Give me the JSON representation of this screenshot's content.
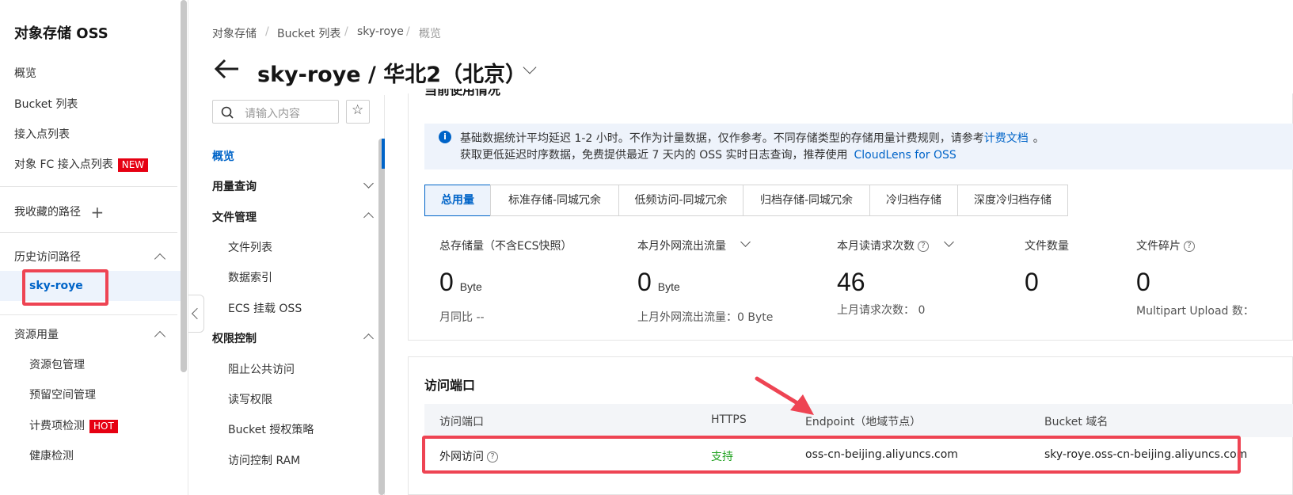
{
  "sidebar": {
    "title": "对象存储 OSS",
    "items": [
      {
        "label": "概览"
      },
      {
        "label": "Bucket 列表"
      },
      {
        "label": "接入点列表"
      },
      {
        "label": "对象 FC 接入点列表",
        "badge": "NEW"
      }
    ],
    "favorites": "我收藏的路径",
    "history": {
      "label": "历史访问路径",
      "active_item": "sky-roye"
    },
    "resources": {
      "label": "资源用量",
      "items": [
        {
          "label": "资源包管理"
        },
        {
          "label": "预留空间管理"
        },
        {
          "label": "计费项检测",
          "badge": "HOT"
        },
        {
          "label": "健康检测"
        }
      ]
    }
  },
  "breadcrumb": [
    "对象存储",
    "Bucket 列表",
    "sky-roye",
    "概览"
  ],
  "page_title": "sky-roye / 华北2（北京）",
  "inner_nav": {
    "search_placeholder": "请输入内容",
    "items": {
      "overview": "概览",
      "usage_query": "用量查询",
      "file_mgmt": "文件管理",
      "file_list": "文件列表",
      "data_index": "数据索引",
      "ecs_mount": "ECS 挂载 OSS",
      "access_control": "权限控制",
      "block_public": "阻止公共访问",
      "rw_perm": "读写权限",
      "bucket_policy": "Bucket 授权策略",
      "ram_control": "访问控制 RAM"
    }
  },
  "usage": {
    "section_title": "当前使用情况",
    "info_line1_a": "基础数据统计平均延迟 1-2 小时。不作为计量数据，仅作参考。不同存储类型的存储用量计费规则，请参考",
    "info_link1": "计费文档",
    "info_line1_b": "。",
    "info_line2_a": "获取更低延迟时序数据，免费提供最近 7 天内的 OSS 实时日志查询，推荐使用",
    "info_link2": "CloudLens for OSS",
    "tabs": [
      "总用量",
      "标准存储-同城冗余",
      "低频访问-同城冗余",
      "归档存储-同城冗余",
      "冷归档存储",
      "深度冷归档存储"
    ],
    "active_tab": "总用量",
    "metrics": {
      "storage": {
        "label": "总存储量（不含ECS快照）",
        "value": "0",
        "unit": "Byte",
        "sub": "月同比 --"
      },
      "traffic": {
        "label": "本月外网流出流量",
        "value": "0",
        "unit": "Byte",
        "sub": "上月外网流出流量：0 Byte"
      },
      "requests": {
        "label": "本月读请求次数",
        "value": "46",
        "sub": "上月请求次数：  0"
      },
      "files": {
        "label": "文件数量",
        "value": "0"
      },
      "fragments": {
        "label": "文件碎片",
        "value": "0",
        "sub": "Multipart Upload 数："
      }
    }
  },
  "endpoint": {
    "section_title": "访问端口",
    "headers": [
      "访问端口",
      "HTTPS",
      "Endpoint（地域节点）",
      "Bucket 域名"
    ],
    "row": {
      "port": "外网访问",
      "https": "支持",
      "endpoint": "oss-cn-beijing.aliyuncs.com",
      "domain": "sky-roye.oss-cn-beijing.aliyuncs.com"
    }
  },
  "colors": {
    "accent": "#0064c8",
    "highlight": "#ee4453",
    "success": "#22a322",
    "badge": "#e60012"
  }
}
